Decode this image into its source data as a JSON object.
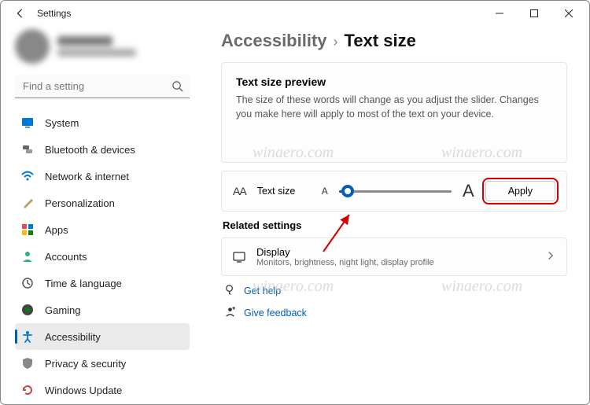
{
  "window": {
    "title": "Settings"
  },
  "search": {
    "placeholder": "Find a setting"
  },
  "nav": {
    "items": [
      {
        "label": "System"
      },
      {
        "label": "Bluetooth & devices"
      },
      {
        "label": "Network & internet"
      },
      {
        "label": "Personalization"
      },
      {
        "label": "Apps"
      },
      {
        "label": "Accounts"
      },
      {
        "label": "Time & language"
      },
      {
        "label": "Gaming"
      },
      {
        "label": "Accessibility"
      },
      {
        "label": "Privacy & security"
      },
      {
        "label": "Windows Update"
      }
    ],
    "active_index": 8
  },
  "breadcrumb": {
    "parent": "Accessibility",
    "separator": "›",
    "current": "Text size"
  },
  "preview": {
    "heading": "Text size preview",
    "body": "The size of these words will change as you adjust the slider. Changes you make here will apply to most of the text on your device."
  },
  "slider_row": {
    "icon_text": "AA",
    "label": "Text size",
    "small_a": "A",
    "big_a": "A",
    "apply_label": "Apply",
    "value_percent": 8
  },
  "related": {
    "heading": "Related settings",
    "display": {
      "title": "Display",
      "subtitle": "Monitors, brightness, night light, display profile"
    }
  },
  "help": {
    "get_help": "Get help",
    "give_feedback": "Give feedback"
  },
  "watermark": "winaero.com",
  "colors": {
    "accent": "#005fb8",
    "highlight_box": "#d40000"
  }
}
